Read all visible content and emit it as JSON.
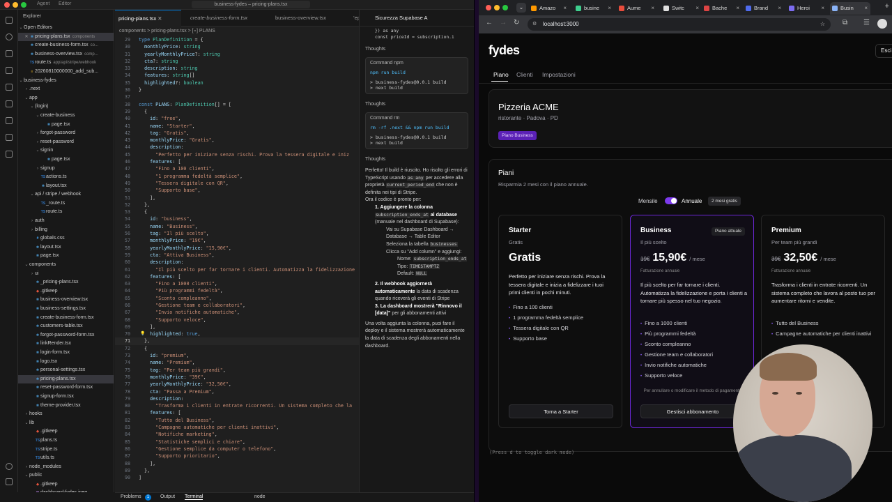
{
  "vscode": {
    "title_items": [
      "Agent",
      "Editor"
    ],
    "window_title": "business-fydes – pricing-plans.tsx",
    "explorer_title": "Explorer",
    "open_editors_label": "Open Editors",
    "open_editors": [
      {
        "name": "pricing-plans.tsx",
        "desc": "components"
      },
      {
        "name": "create-business-form.tsx",
        "desc": "co..."
      },
      {
        "name": "business-overview.tsx",
        "desc": "comp..."
      },
      {
        "name": "route.ts",
        "desc": "app/api/stripe/webhook"
      },
      {
        "name": "20260810000000_add_sub...",
        "desc": ""
      }
    ],
    "project_name": "business-fydes",
    "tree": [
      {
        "name": ".next",
        "depth": 1,
        "kind": "folder-closed"
      },
      {
        "name": "app",
        "depth": 1,
        "kind": "folder-open"
      },
      {
        "name": "(login)",
        "depth": 2,
        "kind": "folder-open"
      },
      {
        "name": "create-business",
        "depth": 3,
        "kind": "folder-open"
      },
      {
        "name": "page.tsx",
        "depth": 4,
        "kind": "tsx"
      },
      {
        "name": "forgot-password",
        "depth": 3,
        "kind": "folder-closed"
      },
      {
        "name": "reset-password",
        "depth": 3,
        "kind": "folder-closed"
      },
      {
        "name": "signin",
        "depth": 3,
        "kind": "folder-open"
      },
      {
        "name": "page.tsx",
        "depth": 4,
        "kind": "tsx"
      },
      {
        "name": "signup",
        "depth": 3,
        "kind": "folder-closed"
      },
      {
        "name": "actions.ts",
        "depth": 3,
        "kind": "ts"
      },
      {
        "name": "layout.tsx",
        "depth": 3,
        "kind": "tsx"
      },
      {
        "name": "api / stripe / webhook",
        "depth": 2,
        "kind": "folder-open"
      },
      {
        "name": "_route.ts",
        "depth": 3,
        "kind": "ts"
      },
      {
        "name": "route.ts",
        "depth": 3,
        "kind": "ts"
      },
      {
        "name": "auth",
        "depth": 2,
        "kind": "folder-closed"
      },
      {
        "name": "billing",
        "depth": 2,
        "kind": "folder-closed"
      },
      {
        "name": "globals.css",
        "depth": 2,
        "kind": "css"
      },
      {
        "name": "layout.tsx",
        "depth": 2,
        "kind": "tsx"
      },
      {
        "name": "page.tsx",
        "depth": 2,
        "kind": "tsx"
      },
      {
        "name": "components",
        "depth": 1,
        "kind": "folder-open"
      },
      {
        "name": "ui",
        "depth": 2,
        "kind": "folder-closed"
      },
      {
        "name": "_pricing-plans.tsx",
        "depth": 2,
        "kind": "tsx"
      },
      {
        "name": ".gitkeep",
        "depth": 2,
        "kind": "git"
      },
      {
        "name": "business-overview.tsx",
        "depth": 2,
        "kind": "tsx"
      },
      {
        "name": "business-settings.tsx",
        "depth": 2,
        "kind": "tsx"
      },
      {
        "name": "create-business-form.tsx",
        "depth": 2,
        "kind": "tsx"
      },
      {
        "name": "customers-table.tsx",
        "depth": 2,
        "kind": "tsx"
      },
      {
        "name": "forgot-password-form.tsx",
        "depth": 2,
        "kind": "tsx"
      },
      {
        "name": "linkRender.tsx",
        "depth": 2,
        "kind": "tsx"
      },
      {
        "name": "login-form.tsx",
        "depth": 2,
        "kind": "tsx"
      },
      {
        "name": "logo.tsx",
        "depth": 2,
        "kind": "tsx"
      },
      {
        "name": "personal-settings.tsx",
        "depth": 2,
        "kind": "tsx"
      },
      {
        "name": "pricing-plans.tsx",
        "depth": 2,
        "kind": "tsx",
        "active": true
      },
      {
        "name": "reset-password-form.tsx",
        "depth": 2,
        "kind": "tsx"
      },
      {
        "name": "signup-form.tsx",
        "depth": 2,
        "kind": "tsx"
      },
      {
        "name": "theme-provider.tsx",
        "depth": 2,
        "kind": "tsx"
      },
      {
        "name": "hooks",
        "depth": 1,
        "kind": "folder-closed"
      },
      {
        "name": "lib",
        "depth": 1,
        "kind": "folder-open"
      },
      {
        "name": ".gitkeep",
        "depth": 2,
        "kind": "git"
      },
      {
        "name": "plans.ts",
        "depth": 2,
        "kind": "ts"
      },
      {
        "name": "stripe.ts",
        "depth": 2,
        "kind": "ts"
      },
      {
        "name": "utils.ts",
        "depth": 2,
        "kind": "ts"
      },
      {
        "name": "node_modules",
        "depth": 1,
        "kind": "folder-closed"
      },
      {
        "name": "public",
        "depth": 1,
        "kind": "folder-open"
      },
      {
        "name": ".gitkeep",
        "depth": 2,
        "kind": "git"
      },
      {
        "name": "dashboard-fydes.jpeg",
        "depth": 2,
        "kind": "img"
      }
    ],
    "tabs": [
      {
        "label": "pricing-plans.tsx",
        "active": true,
        "italic": false
      },
      {
        "label": "create-business-form.tsx",
        "active": false,
        "italic": true
      },
      {
        "label": "business-overview.tsx",
        "active": false,
        "italic": false
      },
      {
        "label": "’ep",
        "active": false,
        "italic": false
      }
    ],
    "breadcrumb": "components > pricing-plans.tsx > [∘] PLANS",
    "code": [
      [
        29,
        "type PlanDefinition = {"
      ],
      [
        30,
        "  monthlyPrice: string"
      ],
      [
        31,
        "  yearlyMonthlyPrice?: string"
      ],
      [
        32,
        "  cta?: string"
      ],
      [
        33,
        "  description: string"
      ],
      [
        34,
        "  features: string[]"
      ],
      [
        35,
        "  highlighted?: boolean"
      ],
      [
        36,
        "}"
      ],
      [
        37,
        ""
      ],
      [
        38,
        "const PLANS: PlanDefinition[] = ["
      ],
      [
        39,
        "  {"
      ],
      [
        40,
        "    id: \"free\","
      ],
      [
        41,
        "    name: \"Starter\","
      ],
      [
        42,
        "    tag: \"Gratis\","
      ],
      [
        43,
        "    monthlyPrice: \"Gratis\","
      ],
      [
        44,
        "    description:"
      ],
      [
        45,
        "      \"Perfetto per iniziare senza rischi. Prova la tessera digitale e iniz"
      ],
      [
        46,
        "    features: ["
      ],
      [
        47,
        "      \"Fino a 100 clienti\","
      ],
      [
        48,
        "      \"1 programma fedeltà semplice\","
      ],
      [
        49,
        "      \"Tessera digitale con QR\","
      ],
      [
        50,
        "      \"Supporto base\","
      ],
      [
        51,
        "    ],"
      ],
      [
        52,
        "  },"
      ],
      [
        53,
        "  {"
      ],
      [
        54,
        "    id: \"business\","
      ],
      [
        55,
        "    name: \"Business\","
      ],
      [
        56,
        "    tag: \"Il più scelto\","
      ],
      [
        57,
        "    monthlyPrice: \"19€\","
      ],
      [
        58,
        "    yearlyMonthlyPrice: \"15,90€\","
      ],
      [
        59,
        "    cta: \"Attiva Business\","
      ],
      [
        60,
        "    description:"
      ],
      [
        61,
        "      \"Il più scelto per far tornare i clienti. Automatizza la fidelizzazione"
      ],
      [
        62,
        "    features: ["
      ],
      [
        63,
        "      \"Fino a 1000 clienti\","
      ],
      [
        64,
        "      \"Più programmi fedeltà\","
      ],
      [
        65,
        "      \"Sconto compleanno\","
      ],
      [
        66,
        "      \"Gestione team e collaboratori\","
      ],
      [
        67,
        "      \"Invio notifiche automatiche\","
      ],
      [
        68,
        "      \"Supporto veloce\","
      ],
      [
        69,
        "    ],"
      ],
      [
        70,
        "    highlighted: true,"
      ],
      [
        71,
        "  },"
      ],
      [
        72,
        "  {"
      ],
      [
        73,
        "    id: \"premium\","
      ],
      [
        74,
        "    name: \"Premium\","
      ],
      [
        75,
        "    tag: \"Per team più grandi\","
      ],
      [
        76,
        "    monthlyPrice: \"39€\","
      ],
      [
        77,
        "    yearlyMonthlyPrice: \"32,50€\","
      ],
      [
        78,
        "    cta: \"Passa a Premium\","
      ],
      [
        79,
        "    description:"
      ],
      [
        80,
        "      \"Trasforma i clienti in entrate ricorrenti. Un sistema completo che la"
      ],
      [
        81,
        "    features: ["
      ],
      [
        82,
        "      \"Tutto del Business\","
      ],
      [
        83,
        "      \"Campagne automatiche per clienti inattivi\","
      ],
      [
        84,
        "      \"Notifiche marketing\","
      ],
      [
        85,
        "      \"Statistiche semplici e chiare\","
      ],
      [
        86,
        "      \"Gestione semplice da computer o telefono\","
      ],
      [
        87,
        "      \"Supporto prioritario\","
      ],
      [
        88,
        "    ],"
      ],
      [
        89,
        "  },"
      ],
      [
        90,
        "]"
      ]
    ],
    "current_line": 71,
    "chat": {
      "title": "Sicurezza Supabase A",
      "top_code_1": "}) as any",
      "top_code_2": "const priceId = subscription.i",
      "thoughts": "Thoughts",
      "cmd1_title": "Command npm",
      "cmd1": "npm run build",
      "cmd1_out1": "> business-fydes@0.0.1 build",
      "cmd1_out2": "> next build",
      "cmd2_title": "Command rm",
      "cmd2": "rm -rf .next && npm run build",
      "cmd2_out1": "> business-fydes@0.0.1 build",
      "cmd2_out2": "> next build",
      "para1_a": "Perfetto! Il build è riuscito. Ho risolto gli errori di TypeScript usando",
      "para1_code1": "as any",
      "para1_b": "per accedere alla proprietà",
      "para1_code2": "current_period_end",
      "para1_c": "che non è definita nei tipi di Stripe.",
      "para2": "Ora il codice è pronto per:",
      "item1_a": "1. Aggiungere la colonna",
      "item1_code": "subscription_ends_at",
      "item1_b": "al database",
      "item1_c": "(manuale nel dashboard di Supabase):",
      "sub1": "Vai su Supabase Dashboard → Database → Table Editor",
      "sub2_a": "Seleziona la tabella",
      "sub2_code": "businesses",
      "sub3": "Clicca su \"Add column\" e aggiungi:",
      "sub4_a": "Nome:",
      "sub4_code": "subscription_ends_at",
      "sub5_a": "Tipo:",
      "sub5_code": "TIMESTAMPTZ",
      "sub6_a": "Default:",
      "sub6_code": "NULL",
      "item2_a": "2. Il webhook aggiornerà automaticamente",
      "item2_b": "la data di scadenza quando riceverà gli eventi di Stripe",
      "item3_a": "3. La dashboard mostrerà \"Rinnovo il [data]\"",
      "item3_b": "per gli abbonamenti attivi",
      "para3": "Una volta aggiunta la colonna, puoi fare il deploy e il sistema mostrerà automaticamente la data di scadenza degli abbonamenti nella dashboard."
    },
    "statusbar": {
      "problems": "Problems",
      "problems_count": "1",
      "output": "Output",
      "terminal": "Terminal",
      "node": "node"
    }
  },
  "browser": {
    "tabs": [
      {
        "label": "Amazo",
        "color": "#ff9900"
      },
      {
        "label": "busine",
        "color": "#3ecf8e"
      },
      {
        "label": "Aume",
        "color": "#e74c3c"
      },
      {
        "label": "Switc",
        "color": "#e0e0e0"
      },
      {
        "label": "Bache",
        "color": "#d44"
      },
      {
        "label": "Brand",
        "color": "#4f6bed"
      },
      {
        "label": "Heroi",
        "color": "#7c6cf0"
      },
      {
        "label": "Busin",
        "color": "#8ab4f8",
        "active": true
      }
    ],
    "url": "localhost:3000",
    "app": {
      "logo": "fydes",
      "logout": "Esci",
      "nav": [
        "Piano",
        "Clienti",
        "Impostazioni"
      ],
      "business_name": "Pizzeria ACME",
      "business_meta": "ristorante · Padova · PD",
      "business_badge": "Piano Business",
      "plans_title": "Piani",
      "plans_subtitle": "Risparmia 2 mesi con il piano annuale.",
      "toggle_monthly": "Mensile",
      "toggle_yearly": "Annuale",
      "toggle_badge": "2 mesi gratis",
      "toggle_on": true,
      "plans": [
        {
          "name": "Starter",
          "tag": "Gratis",
          "old_price": "",
          "price": "Gratis",
          "per": "",
          "billing": "",
          "description": "Perfetto per iniziare senza rischi. Prova la tessera digitale e inizia a fidelizzare i tuoi primi clienti in pochi minuti.",
          "features": [
            "Fino a 100 clienti",
            "1 programma fedeltà semplice",
            "Tessera digitale con QR",
            "Supporto base"
          ],
          "note": "",
          "button": "Torna a Starter",
          "current": false
        },
        {
          "name": "Business",
          "tag": "Il più scelto",
          "old_price": "19€",
          "price": "15,90€",
          "per": "/ mese",
          "billing": "Fatturazione annuale",
          "description": "Il più scelto per far tornare i clienti. Automatizza la fidelizzazione e porta i clienti a tornare più spesso nel tuo negozio.",
          "features": [
            "Fino a 1000 clienti",
            "Più programmi fedeltà",
            "Sconto compleanno",
            "Gestione team e collaboratori",
            "Invio notifiche automatiche",
            "Supporto veloce"
          ],
          "note": "Per annullare o modificare il metodo di pagamento",
          "button": "Gestisci abbonamento",
          "current": true,
          "current_badge": "Piano attuale"
        },
        {
          "name": "Premium",
          "tag": "Per team più grandi",
          "old_price": "39€",
          "price": "32,50€",
          "per": "/ mese",
          "billing": "Fatturazione annuale",
          "description": "Trasforma i clienti in entrate ricorrenti. Un sistema completo che lavora al posto tuo per aumentare ritorni e vendite.",
          "features": [
            "Tutto del Business",
            "Campagne automatiche per clienti inattivi"
          ],
          "note": "",
          "button": "",
          "current": false
        }
      ],
      "hint": "(Press d to toggle dark mode)"
    }
  },
  "colors": {
    "accent": "#7c3aed",
    "vscode_bg": "#1f1f1f",
    "browser_bg": "#0a0a0a"
  }
}
